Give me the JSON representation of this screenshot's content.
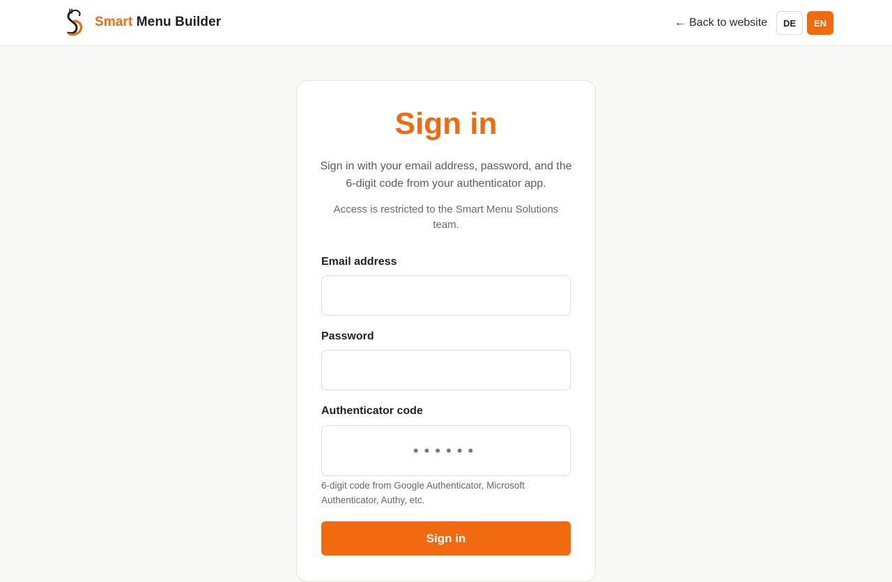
{
  "header": {
    "brand_accent": "Smart",
    "brand_rest": "Menu Builder",
    "back_link": "Back to website",
    "back_arrow": "←",
    "languages": [
      "DE",
      "EN"
    ],
    "active_language": "EN"
  },
  "form": {
    "title": "Sign in",
    "intro": "Sign in with your email address, password, and the 6-digit code from your authenticator app.",
    "note": "Access is restricted to the Smart Menu Solutions team.",
    "email_label": "Email address",
    "email_value": "",
    "password_label": "Password",
    "password_value": "",
    "code_label": "Authenticator code",
    "code_placeholder": "••••••",
    "code_help": "6-digit code from Google Authenticator, Microsoft Authenticator, Authy, etc.",
    "submit_label": "Sign in"
  },
  "colors": {
    "accent": "#f26a0f",
    "background": "#f8f8f6"
  },
  "icons": {
    "logo": "chef-s-logo-icon",
    "back": "arrow-left-icon"
  }
}
